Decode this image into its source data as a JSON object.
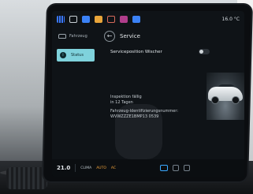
{
  "status_bar": {
    "temperature": "16.0 °C"
  },
  "topbar": {
    "section": "Fahrzeug",
    "title": "Service"
  },
  "sidebar": {
    "active_item": "Status"
  },
  "settings": {
    "service_position_label": "Serviceposition Wischer"
  },
  "service_info": {
    "inspection_label": "Inspektion fällig",
    "inspection_due": "in 12 Tagen",
    "vin_label": "Fahrzeug-Identifizierungsnummer:",
    "vin_value": "WVWZZZE1BMP13 0539"
  },
  "climate_bar": {
    "temperature": "21.0",
    "clima": "CLIMA",
    "auto": "AUTO",
    "ac": "AC"
  },
  "colors": {
    "accent": "#7fd2dc",
    "climate_orange": "#f0a23b",
    "home_blue": "#3aa9ff"
  }
}
